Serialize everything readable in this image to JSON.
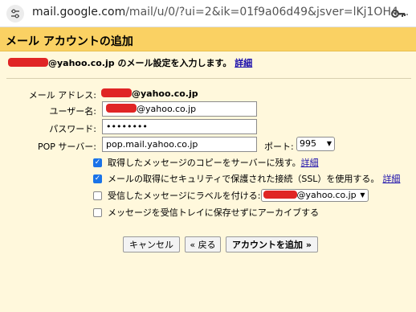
{
  "browser": {
    "url_domain": "mail.google.com",
    "url_path": "/mail/u/0/?ui=2&ik=01f9a06d49&jsver=lKj1OH4...",
    "settings_icon": "tune-icon",
    "key_icon": "key-icon"
  },
  "dialog": {
    "title": "メール アカウントの追加",
    "intro_suffix": "@yahoo.co.jp のメール設定を入力します。",
    "details_link": "詳細"
  },
  "form": {
    "email_label": "メール アドレス:",
    "email_suffix": "@yahoo.co.jp",
    "username_label": "ユーザー名:",
    "username_suffix": "@yahoo.co.jp",
    "password_label": "パスワード:",
    "password_value": "••••••••",
    "pop_label": "POP サーバー:",
    "pop_value": "pop.mail.yahoo.co.jp",
    "port_label": "ポート:",
    "port_value": "995"
  },
  "options": [
    {
      "label": "取得したメッセージのコピーをサーバーに残す。",
      "link": "詳細",
      "checked": true
    },
    {
      "label": "メールの取得にセキュリティで保護された接続（SSL）を使用する。",
      "link": "詳細",
      "checked": true
    },
    {
      "label": "受信したメッセージにラベルを付ける:",
      "select_suffix": "@yahoo.co.jp",
      "checked": false
    },
    {
      "label": "メッセージを受信トレイに保存せずにアーカイブする",
      "checked": false
    }
  ],
  "buttons": {
    "cancel": "キャンセル",
    "back": "« 戻る",
    "add": "アカウントを追加 »"
  },
  "colors": {
    "title_bg": "#fad163",
    "body_bg": "#fff8dc",
    "redaction": "#e02525",
    "checkbox": "#1a73e8"
  }
}
